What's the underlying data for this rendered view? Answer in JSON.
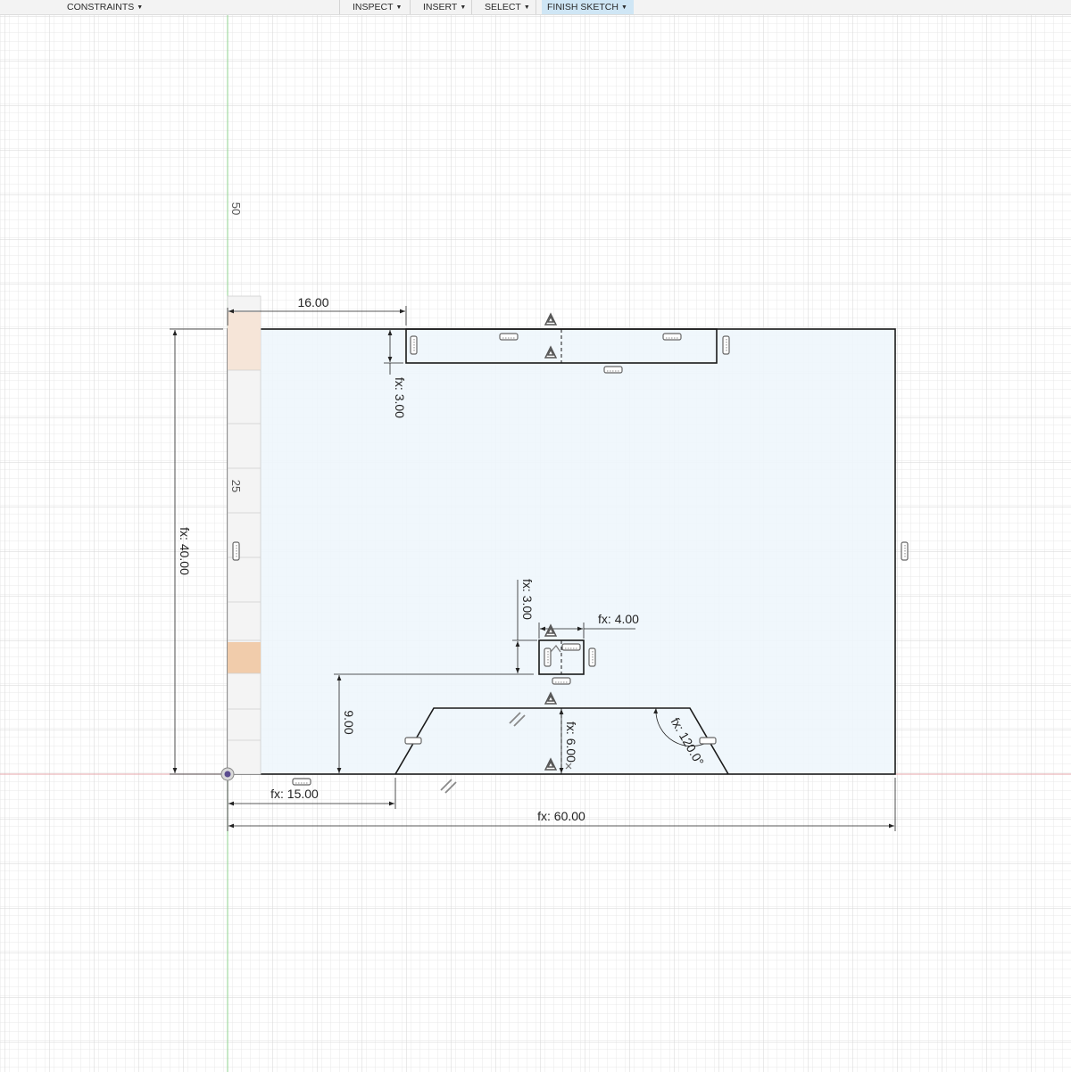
{
  "toolbar": {
    "constraints": "CONSTRAINTS",
    "inspect": "INSPECT",
    "insert": "INSERT",
    "select": "SELECT",
    "finish_sketch": "FINISH SKETCH"
  },
  "ruler": {
    "label_top": "50",
    "label_mid": "25"
  },
  "dimensions": {
    "top_offset": "16.00",
    "slot_height": "fx: 3.00",
    "overall_height": "fx: 40.00",
    "square_height": "fx: 3.00",
    "square_width": "fx: 4.00",
    "center_offset": "9.00",
    "trapezoid_height": "fx: 6.00",
    "trapezoid_angle": "fx: 120.0°",
    "bottom_offset": "fx: 15.00",
    "overall_width": "fx: 60.00"
  },
  "colors": {
    "sketch_fill": "#eef6fc",
    "sketch_line": "#1a1a1a",
    "dimension_line": "#222222",
    "grid_minor": "#e9e9e9",
    "grid_major": "#d6d6d6",
    "axis_y": "#8fd38f",
    "axis_x": "#e4a6aa",
    "active_menu": "#cfe6f5"
  },
  "icons": [
    "caret-down-icon",
    "origin-icon",
    "horizontal-constraint-icon",
    "vertical-constraint-icon",
    "midpoint-constraint-icon",
    "parallel-constraint-icon",
    "coincident-constraint-icon"
  ]
}
